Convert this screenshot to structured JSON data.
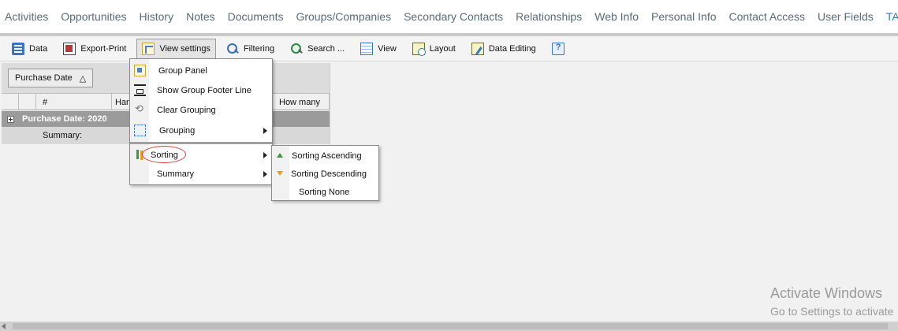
{
  "topnav": {
    "tabs": [
      "Activities",
      "Opportunities",
      "History",
      "Notes",
      "Documents",
      "Groups/Companies",
      "Secondary Contacts",
      "Relationships",
      "Web Info",
      "Personal Info",
      "Contact Access",
      "User Fields",
      "TABLE|IT"
    ]
  },
  "toolbar": {
    "data": "Data",
    "export_print": "Export-Print",
    "view_settings": "View settings",
    "filtering": "Filtering",
    "search": "Search ...",
    "view": "View",
    "layout": "Layout",
    "data_editing": "Data Editing"
  },
  "grid": {
    "group_chip": "Purchase Date",
    "group_chip_arrow": "△",
    "columns": {
      "num": "#",
      "har": "Har",
      "how_many": "How many"
    },
    "group_row": "Purchase Date: 2020",
    "summary": "Summary:"
  },
  "menu": {
    "group_panel": "Group Panel",
    "show_group_footer": "Show Group Footer Line",
    "clear_grouping": "Clear Grouping",
    "grouping": "Grouping",
    "sorting": "Sorting",
    "summary": "Summary"
  },
  "submenu": {
    "asc": "Sorting Ascending",
    "desc": "Sorting Descending",
    "none": "Sorting None"
  },
  "watermark": {
    "line1": "Activate Windows",
    "line2": "Go to Settings to activate"
  },
  "colors": {
    "active_tab": "#2f7fb5",
    "group_row": "#9b9b9b",
    "highlight": "#d23a3a"
  }
}
